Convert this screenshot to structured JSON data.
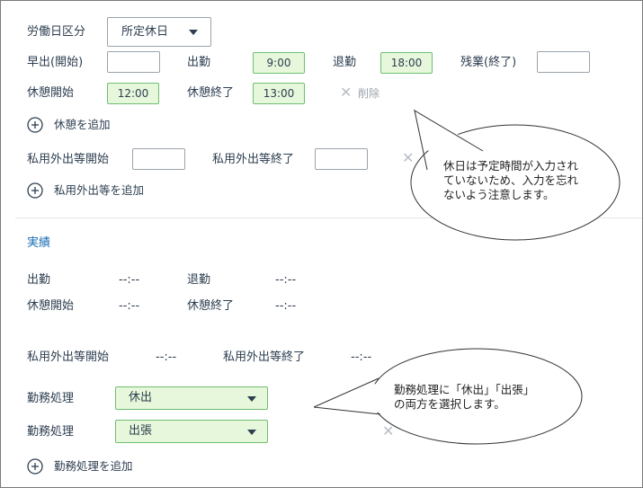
{
  "form": {
    "workday_type_label": "労働日区分",
    "workday_type_value": "所定休日",
    "early_start_label": "早出(開始)",
    "attend_label": "出勤",
    "attend_value": "9:00",
    "leave_label": "退勤",
    "leave_value": "18:00",
    "overtime_end_label": "残業(終了)",
    "break_start_label": "休憩開始",
    "break_start_value": "12:00",
    "break_end_label": "休憩終了",
    "break_end_value": "13:00",
    "delete_label": "削除",
    "add_break_label": "休憩を追加",
    "private_out_start_label": "私用外出等開始",
    "private_out_end_label": "私用外出等終了",
    "add_private_out_label": "私用外出等を追加"
  },
  "results": {
    "section_title": "実績",
    "attend_label": "出勤",
    "attend_value": "--:--",
    "leave_label": "退勤",
    "leave_value": "--:--",
    "break_start_label": "休憩開始",
    "break_start_value": "--:--",
    "break_end_label": "休憩終了",
    "break_end_value": "--:--",
    "private_out_start_label": "私用外出等開始",
    "private_out_start_value": "--:--",
    "private_out_end_label": "私用外出等終了",
    "private_out_end_value": "--:--",
    "work_process_label_1": "勤務処理",
    "work_process_value_1": "休出",
    "work_process_label_2": "勤務処理",
    "work_process_value_2": "出張",
    "add_work_process_label": "勤務処理を追加"
  },
  "callouts": {
    "callout1_lines": [
      "休日は予定時間が入力され",
      "ていないため、入力を忘れ",
      "ないよう注意します。"
    ],
    "callout2_lines": [
      "勤務処理に「休出」「出張」",
      "の両方を選択します。"
    ]
  },
  "colors": {
    "accent": "#1a6fb5",
    "time_box_bg": "#e6f7dc",
    "time_box_border": "#6fbf73",
    "text": "#2d3e50"
  }
}
